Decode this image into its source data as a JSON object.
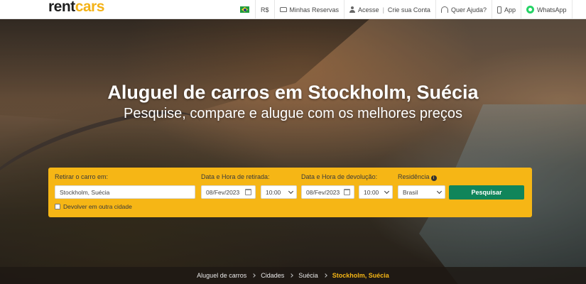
{
  "header": {
    "logo_rent": "rent",
    "logo_cars": "cars",
    "currency": "R$",
    "my_reservations": "Minhas Reservas",
    "login": "Acesse",
    "signup": "Crie sua Conta",
    "help": "Quer Ajuda?",
    "app": "App",
    "whatsapp": "WhatsApp"
  },
  "hero": {
    "title": "Aluguel de carros em Stockholm, Suécia",
    "subtitle": "Pesquise, compare e alugue com os melhores preços"
  },
  "search": {
    "pickup_label": "Retirar o carro em:",
    "pickup_value": "Stockholm, Suécia",
    "pickup_datetime_label": "Data e Hora de retirada:",
    "pickup_date": "08/Fev/2023",
    "pickup_time": "10:00",
    "return_datetime_label": "Data e Hora de devolução:",
    "return_date": "08/Fev/2023",
    "return_time": "10:00",
    "residence_label": "Residência",
    "residence_value": "Brasil",
    "search_button": "Pesquisar",
    "other_city_label": "Devolver em outra cidade"
  },
  "breadcrumb": {
    "items": [
      "Aluguel de carros",
      "Cidades",
      "Suécia"
    ],
    "current": "Stockholm, Suécia"
  },
  "colors": {
    "brand_yellow": "#f6b615",
    "button_green": "#10855a"
  }
}
